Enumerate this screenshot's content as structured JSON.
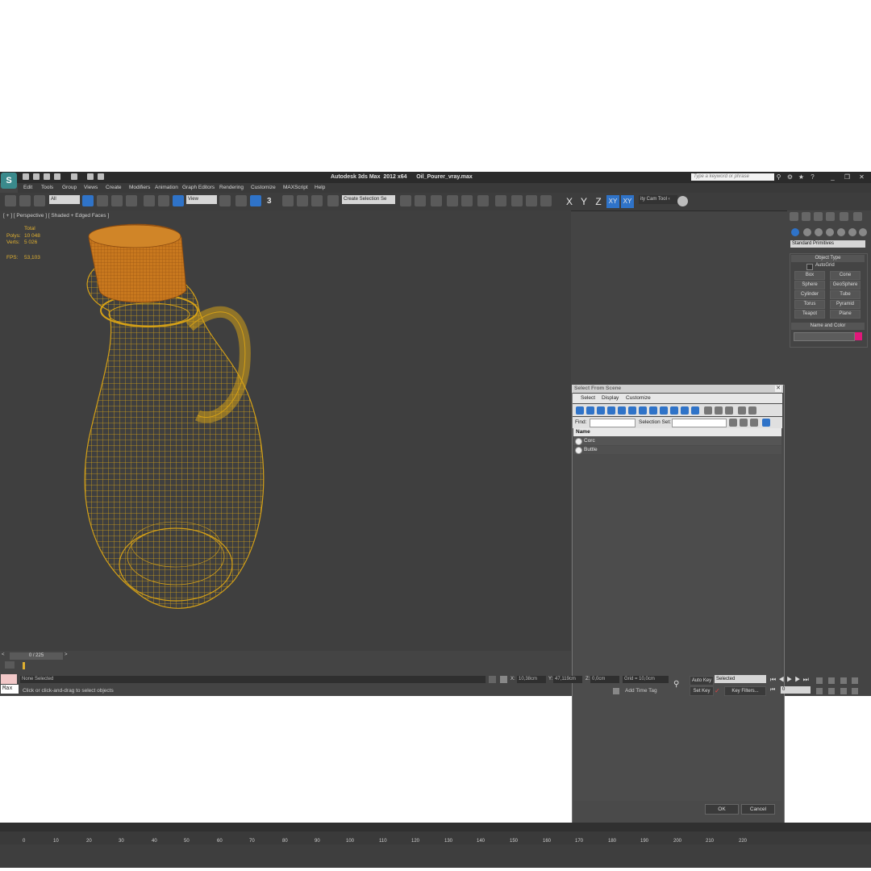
{
  "window": {
    "title": "Autodesk 3ds Max  2012 x64      Oil_Pourer_vray.max",
    "search_placeholder": "Type a keyword or phrase",
    "logo": "3ds-max-logo"
  },
  "menu": [
    "Edit",
    "Tools",
    "Group",
    "Views",
    "Create",
    "Modifiers",
    "Animation",
    "Graph Editors",
    "Rendering",
    "Customize",
    "MAXScript",
    "Help"
  ],
  "toolbar": {
    "selection_filter": "All",
    "ref_coord": "View",
    "snap_label": "3",
    "named_selection": "Create Selection Se",
    "axes": [
      "X",
      "Y",
      "Z",
      "XY"
    ],
    "xy_active": "XY",
    "tool_label": "ity Cam Tool ‹"
  },
  "viewport": {
    "label": "[ + ] [ Perspective ] [ Shaded + Edged Faces ]",
    "stats_header": "Total",
    "polys_label": "Polys:",
    "polys_value": "10 048",
    "verts_label": "Verts:",
    "verts_value": "5 026",
    "fps_label": "FPS:",
    "fps_value": "53,103",
    "wire_color": "#d4a017",
    "cork_color": "#c8781e"
  },
  "dialog": {
    "title": "Select From Scene",
    "menu": [
      "Select",
      "Display",
      "Customize"
    ],
    "find_label": "Find:",
    "selection_set_label": "Selection Set:",
    "column_name": "Name",
    "items": [
      "Corc",
      "Buttle"
    ],
    "ok": "OK",
    "cancel": "Cancel"
  },
  "command_panel": {
    "category": "Standard Primitives",
    "object_type_title": "Object Type",
    "autogrid": "AutoGrid",
    "buttons": [
      "Box",
      "Cone",
      "Sphere",
      "GeoSphere",
      "Cylinder",
      "Tube",
      "Torus",
      "Pyramid",
      "Teapot",
      "Plane"
    ],
    "name_color_title": "Name and Color",
    "color_swatch": "#e0187a"
  },
  "timeline": {
    "frame": "0 / 225",
    "ticks": [
      "0",
      "10",
      "20",
      "30",
      "40",
      "50",
      "60",
      "70",
      "80",
      "90",
      "100",
      "110",
      "120",
      "130",
      "140",
      "150",
      "160",
      "170",
      "180",
      "190",
      "200",
      "210",
      "220"
    ]
  },
  "status": {
    "none_selected": "None Selected",
    "prompt": "Click or click-and-drag to select objects",
    "maxscript": "Max",
    "x_label": "X:",
    "x_value": "10,38cm",
    "y_label": "Y:",
    "y_value": "47,119cm",
    "z_label": "Z:",
    "z_value": "0,0cm",
    "grid": "Grid = 10,0cm",
    "add_time_tag": "Add Time Tag",
    "auto_key": "Auto Key",
    "set_key": "Set Key",
    "selected": "Selected",
    "key_filters": "Key Filters...",
    "frame_value": "0"
  }
}
